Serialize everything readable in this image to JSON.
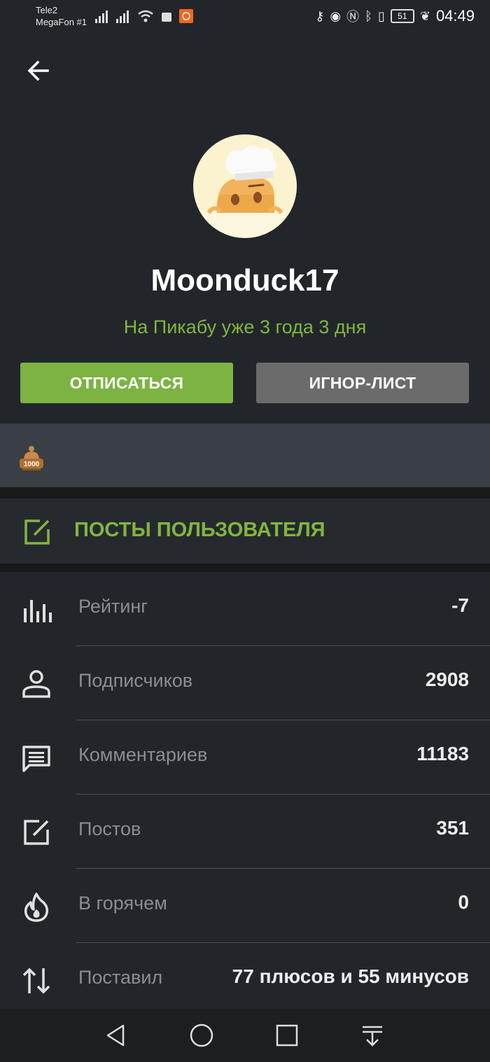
{
  "status_bar": {
    "carrier1": "Tele2",
    "carrier2": "MegaFon #1",
    "battery": "51",
    "time": "04:49"
  },
  "profile": {
    "username": "Moonduck17",
    "since": "На Пикабу уже 3 года 3 дня",
    "avatar_icon": "chef-avatar-icon"
  },
  "buttons": {
    "unsubscribe": "ОТПИСАТЬСЯ",
    "ignore": "ИГНОР-ЛИСТ"
  },
  "awards": {
    "items": [
      {
        "icon": "award-1000-icon",
        "label": "1000"
      }
    ]
  },
  "posts_link": {
    "label": "ПОСТЫ ПОЛЬЗОВАТЕЛЯ",
    "icon": "edit-icon"
  },
  "stats": [
    {
      "icon": "rating-icon",
      "label": "Рейтинг",
      "value": "-7"
    },
    {
      "icon": "person-icon",
      "label": "Подписчиков",
      "value": "2908"
    },
    {
      "icon": "comment-icon",
      "label": "Комментариев",
      "value": "11183"
    },
    {
      "icon": "edit-icon",
      "label": "Постов",
      "value": "351"
    },
    {
      "icon": "flame-icon",
      "label": "В горячем",
      "value": "0"
    },
    {
      "icon": "sort-arrows-icon",
      "label": "Поставил",
      "value": "77 плюсов и 55 минусов"
    }
  ],
  "colors": {
    "accent": "#7cb342",
    "accent_text": "#82b541",
    "background": "#22262a"
  }
}
